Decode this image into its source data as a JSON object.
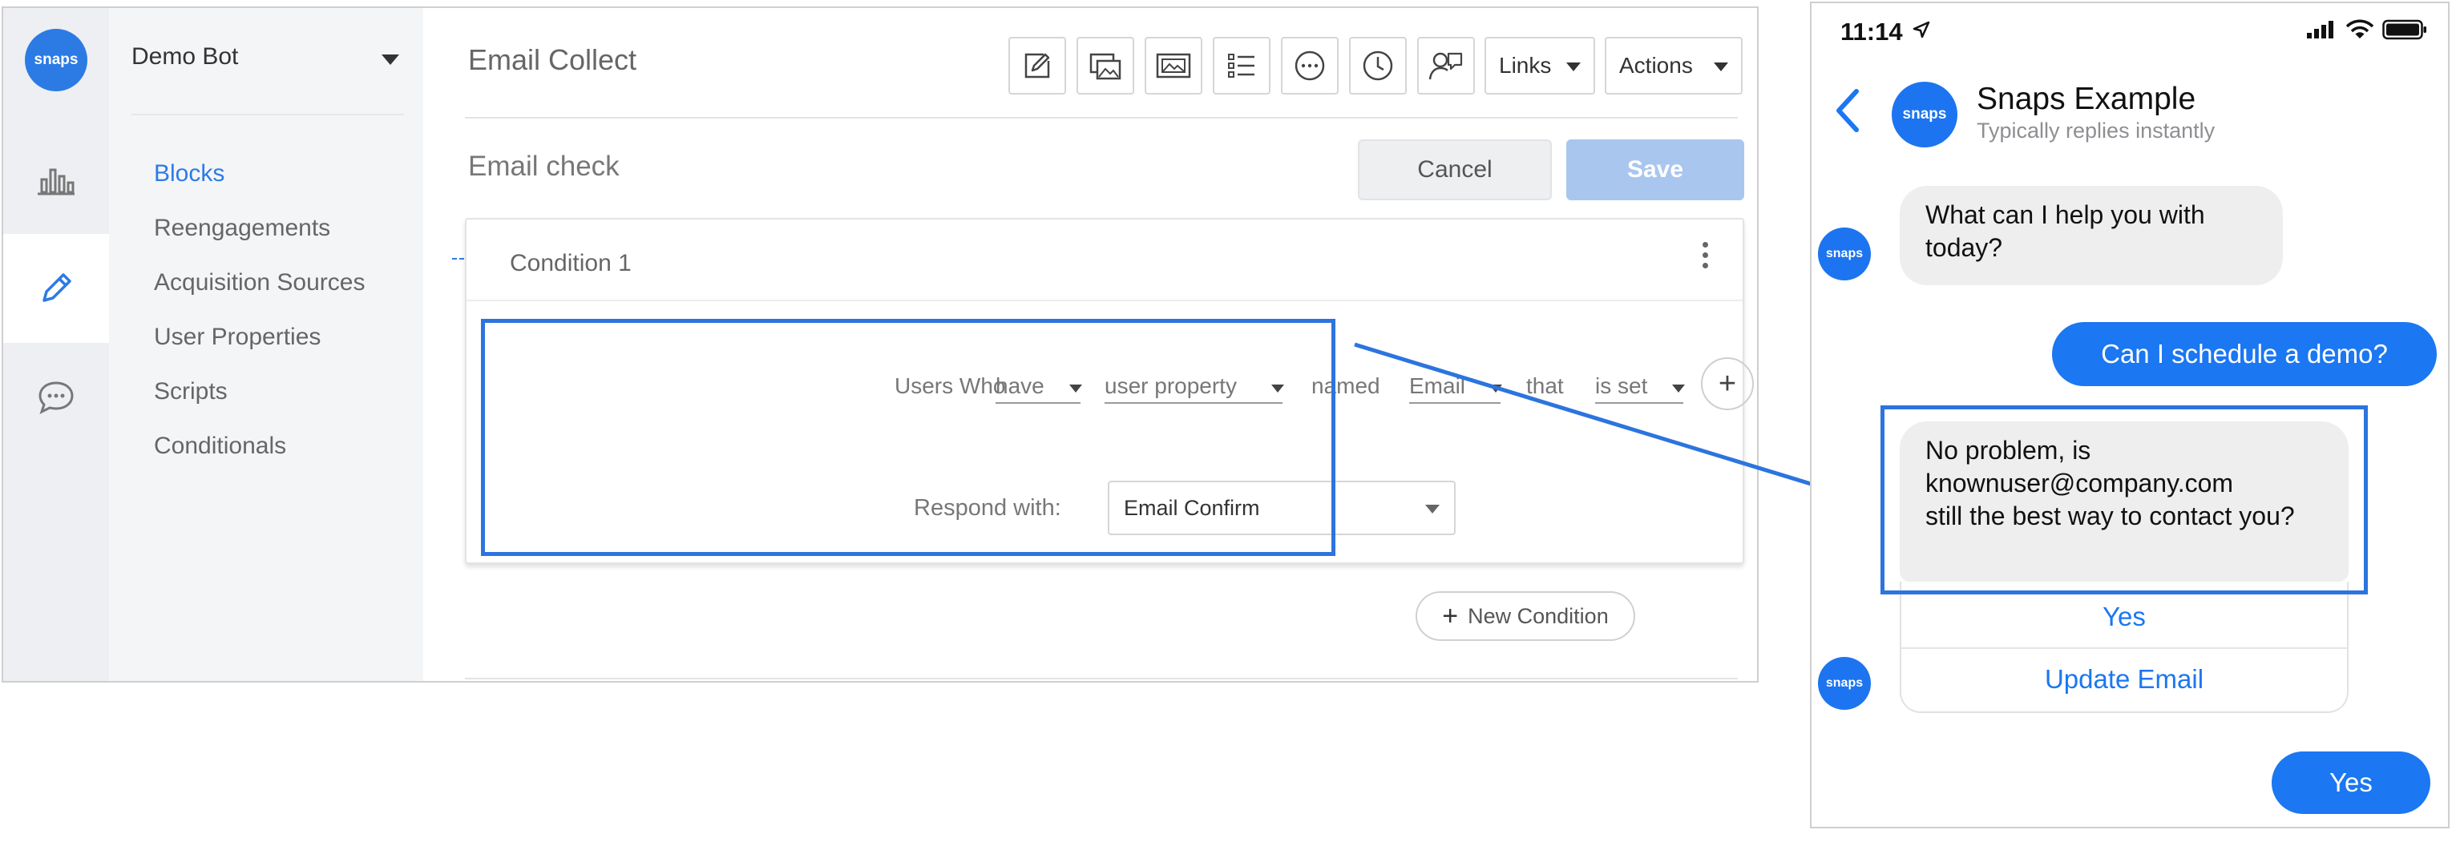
{
  "builder": {
    "logo_text": "snaps",
    "bot_name": "Demo Bot",
    "rail_icons": [
      "analytics-icon",
      "edit-pencil-icon",
      "chat-bubble-icon"
    ],
    "nav_items": [
      {
        "label": "Blocks",
        "active": true
      },
      {
        "label": "Reengagements",
        "active": false
      },
      {
        "label": "Acquisition Sources",
        "active": false
      },
      {
        "label": "User Properties",
        "active": false
      },
      {
        "label": "Scripts",
        "active": false
      },
      {
        "label": "Conditionals",
        "active": false
      }
    ],
    "page_title": "Email Collect",
    "toolbar_icons": [
      "text-card-icon",
      "gallery-icon",
      "image-icon",
      "list-icon",
      "typing-icon",
      "delay-clock-icon",
      "user-input-icon"
    ],
    "links_label": "Links",
    "actions_label": "Actions",
    "block_title": "Email check",
    "cancel_label": "Cancel",
    "save_label": "Save",
    "condition": {
      "title": "Condition 1",
      "users_who": "Users Who",
      "have": "have",
      "user_property": "user property",
      "named": "named",
      "property_name": "Email",
      "that": "that",
      "is_set": "is set",
      "respond_label": "Respond with:",
      "respond_value": "Email Confirm"
    },
    "new_condition_label": "New Condition",
    "accent_color": "#2c7be5"
  },
  "phone": {
    "time": "11:14",
    "contact_name": "Snaps Example",
    "contact_status": "Typically replies instantly",
    "avatar_text": "snaps",
    "messages": {
      "bot_1": "What can I help you with today?",
      "user_1": "Can I schedule a demo?",
      "bot_2_line1": "No problem, is",
      "bot_2_line2": "knownuser@company.com",
      "bot_2_line3": "still the best way to contact you?",
      "user_2": "Yes"
    },
    "quick_replies": [
      "Yes",
      "Update Email"
    ],
    "bubble_color": "#1b77f2"
  }
}
